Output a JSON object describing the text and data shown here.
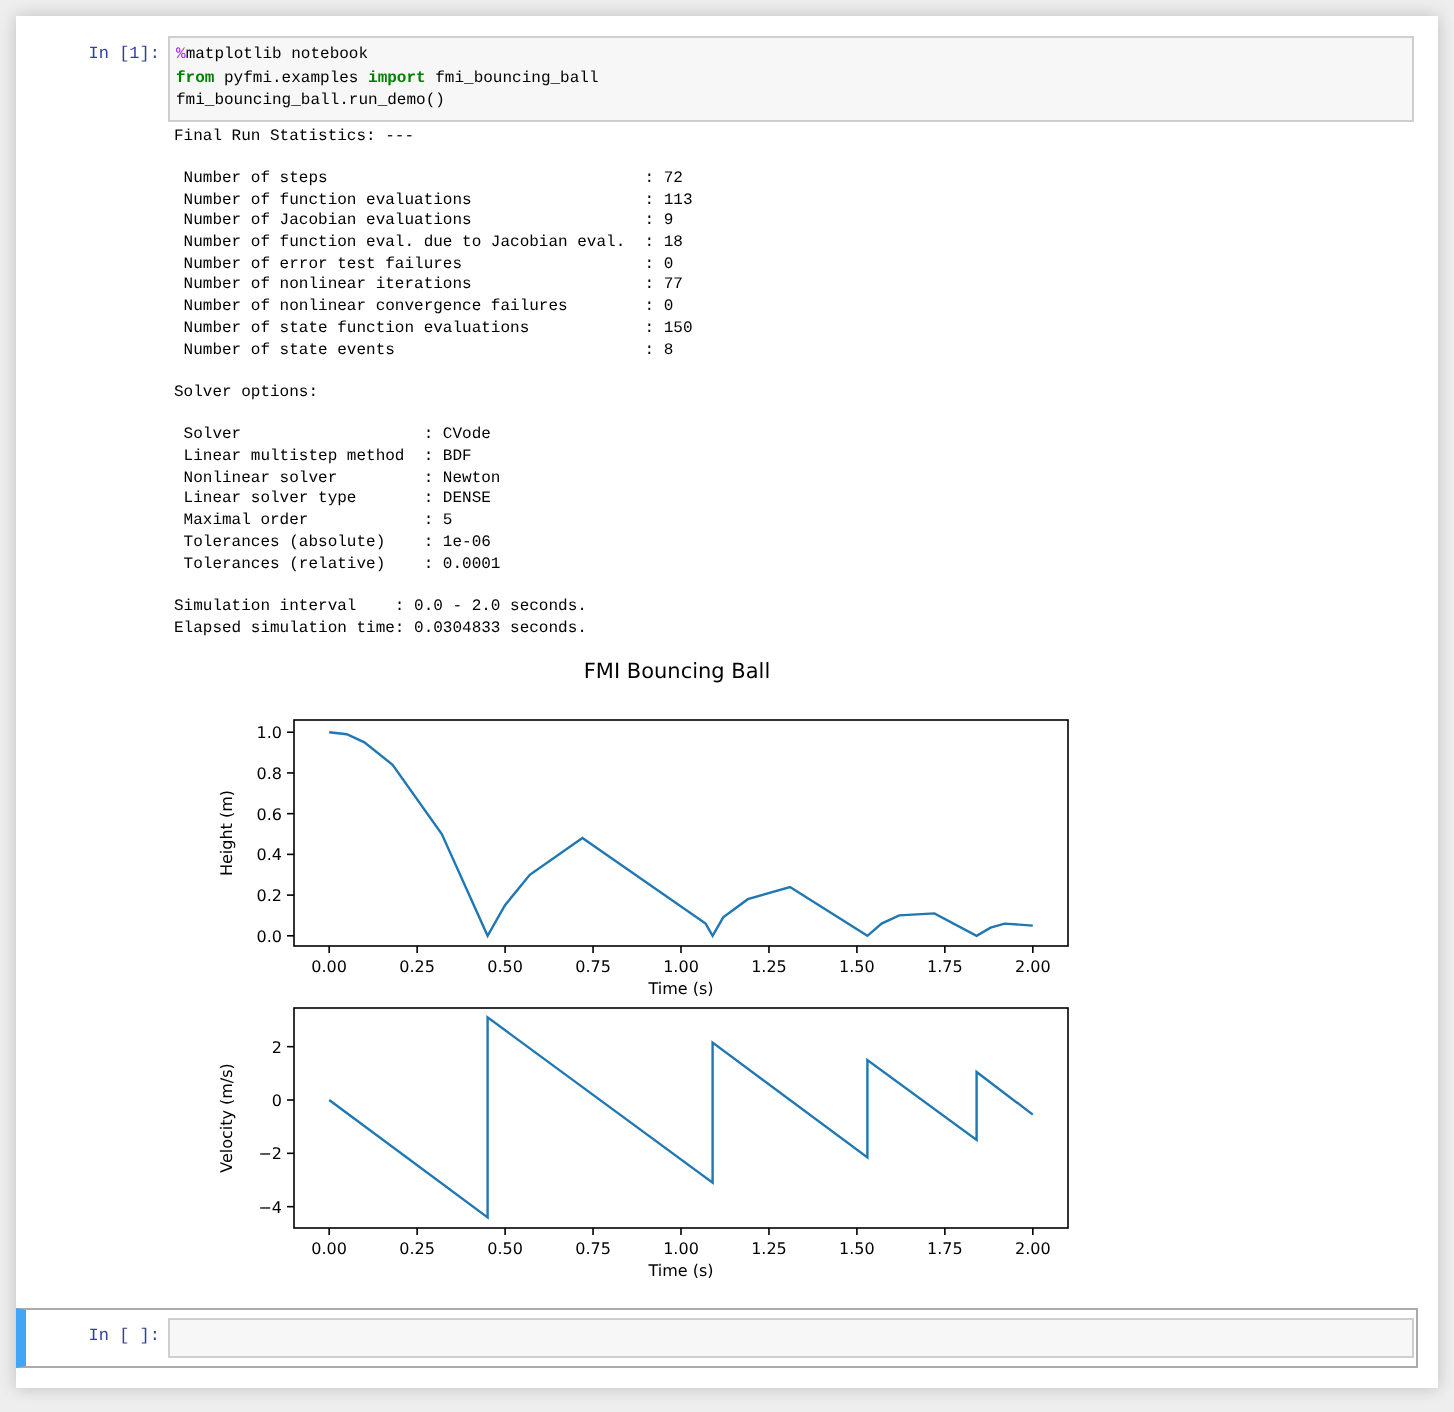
{
  "cells": [
    {
      "prompt": "In [1]:",
      "selected": false,
      "code": [
        [
          {
            "kind": "magic",
            "text": "%"
          },
          {
            "kind": "plain",
            "text": "matplotlib notebook"
          }
        ],
        [
          {
            "kind": "keyword",
            "text": "from"
          },
          {
            "kind": "plain",
            "text": " pyfmi.examples "
          },
          {
            "kind": "keyword",
            "text": "import"
          },
          {
            "kind": "plain",
            "text": " fmi_bouncing_ball"
          }
        ],
        [
          {
            "kind": "plain",
            "text": "fmi_bouncing_ball.run_demo()"
          }
        ]
      ],
      "output": [
        [
          "Final Run Statistics: ---"
        ],
        [
          " Number of steps                                 : 72",
          " Number of function evaluations                  : 113",
          " Number of Jacobian evaluations                  : 9",
          " Number of function eval. due to Jacobian eval.  : 18",
          " Number of error test failures                   : 0",
          " Number of nonlinear iterations                  : 77",
          " Number of nonlinear convergence failures        : 0",
          " Number of state function evaluations            : 150",
          " Number of state events                          : 8"
        ],
        [
          "Solver options:"
        ],
        [
          " Solver                   : CVode",
          " Linear multistep method  : BDF",
          " Nonlinear solver         : Newton",
          " Linear solver type       : DENSE",
          " Maximal order            : 5",
          " Tolerances (absolute)    : 1e-06",
          " Tolerances (relative)    : 0.0001"
        ],
        [
          "Simulation interval    : 0.0 - 2.0 seconds.",
          "Elapsed simulation time: 0.0304833 seconds."
        ]
      ],
      "figure": [
        {
          "chart_data": {
            "type": "line",
            "title": "FMI Bouncing Ball",
            "xlabel": "Time (s)",
            "ylabel": "Height (m)",
            "x": [
              0,
              0.05,
              0.1,
              0.18,
              0.32,
              0.45,
              0.5,
              0.57,
              0.72,
              1.07,
              1.09,
              1.12,
              1.19,
              1.31,
              1.53,
              1.57,
              1.62,
              1.72,
              1.84,
              1.88,
              1.92,
              2.0
            ],
            "series": [
              {
                "color": "#1f77b4",
                "values": [
                  1.0,
                  0.99,
                  0.95,
                  0.84,
                  0.5,
                  0.0,
                  0.15,
                  0.3,
                  0.48,
                  0.06,
                  0.0,
                  0.09,
                  0.18,
                  0.24,
                  0.0,
                  0.06,
                  0.1,
                  0.11,
                  0.0,
                  0.04,
                  0.06,
                  0.05
                ]
              }
            ],
            "xlim": [
              -0.1,
              2.1
            ],
            "ylim": [
              -0.05,
              1.06
            ],
            "xticks": [
              {
                "value": 0,
                "label": "0.00"
              },
              {
                "value": 0.25,
                "label": "0.25"
              },
              {
                "value": 0.5,
                "label": "0.50"
              },
              {
                "value": 0.75,
                "label": "0.75"
              },
              {
                "value": 1,
                "label": "1.00"
              },
              {
                "value": 1.25,
                "label": "1.25"
              },
              {
                "value": 1.5,
                "label": "1.50"
              },
              {
                "value": 1.75,
                "label": "1.75"
              },
              {
                "value": 2,
                "label": "2.00"
              }
            ],
            "yticks": [
              {
                "value": 1,
                "label": "1.0"
              },
              {
                "value": 0.8,
                "label": "0.8"
              },
              {
                "value": 0.6,
                "label": "0.6"
              },
              {
                "value": 0.4,
                "label": "0.4"
              },
              {
                "value": 0.2,
                "label": "0.2"
              },
              {
                "value": 0,
                "label": "0.0"
              }
            ]
          }
        },
        {
          "chart_data": {
            "type": "line",
            "xlabel": "Time (s)",
            "ylabel": "Velocity (m/s)",
            "x": [
              0,
              0.45,
              0.45,
              1.09,
              1.09,
              1.53,
              1.53,
              1.84,
              1.84,
              2.0
            ],
            "series": [
              {
                "color": "#1f77b4",
                "values": [
                  0,
                  -4.4,
                  3.1,
                  -3.1,
                  2.15,
                  -2.15,
                  1.5,
                  -1.5,
                  1.05,
                  -0.55
                ]
              }
            ],
            "xlim": [
              -0.1,
              2.1
            ],
            "ylim": [
              -4.8,
              3.45
            ],
            "xticks": [
              {
                "value": 0,
                "label": "0.00"
              },
              {
                "value": 0.25,
                "label": "0.25"
              },
              {
                "value": 0.5,
                "label": "0.50"
              },
              {
                "value": 0.75,
                "label": "0.75"
              },
              {
                "value": 1,
                "label": "1.00"
              },
              {
                "value": 1.25,
                "label": "1.25"
              },
              {
                "value": 1.5,
                "label": "1.50"
              },
              {
                "value": 1.75,
                "label": "1.75"
              },
              {
                "value": 2,
                "label": "2.00"
              }
            ],
            "yticks": [
              {
                "value": 2,
                "label": "2"
              },
              {
                "value": 0,
                "label": "0"
              },
              {
                "value": -2,
                "label": "−2"
              },
              {
                "value": -4,
                "label": "−4"
              }
            ]
          }
        }
      ]
    },
    {
      "prompt": "In [ ]:",
      "selected": true
    }
  ]
}
